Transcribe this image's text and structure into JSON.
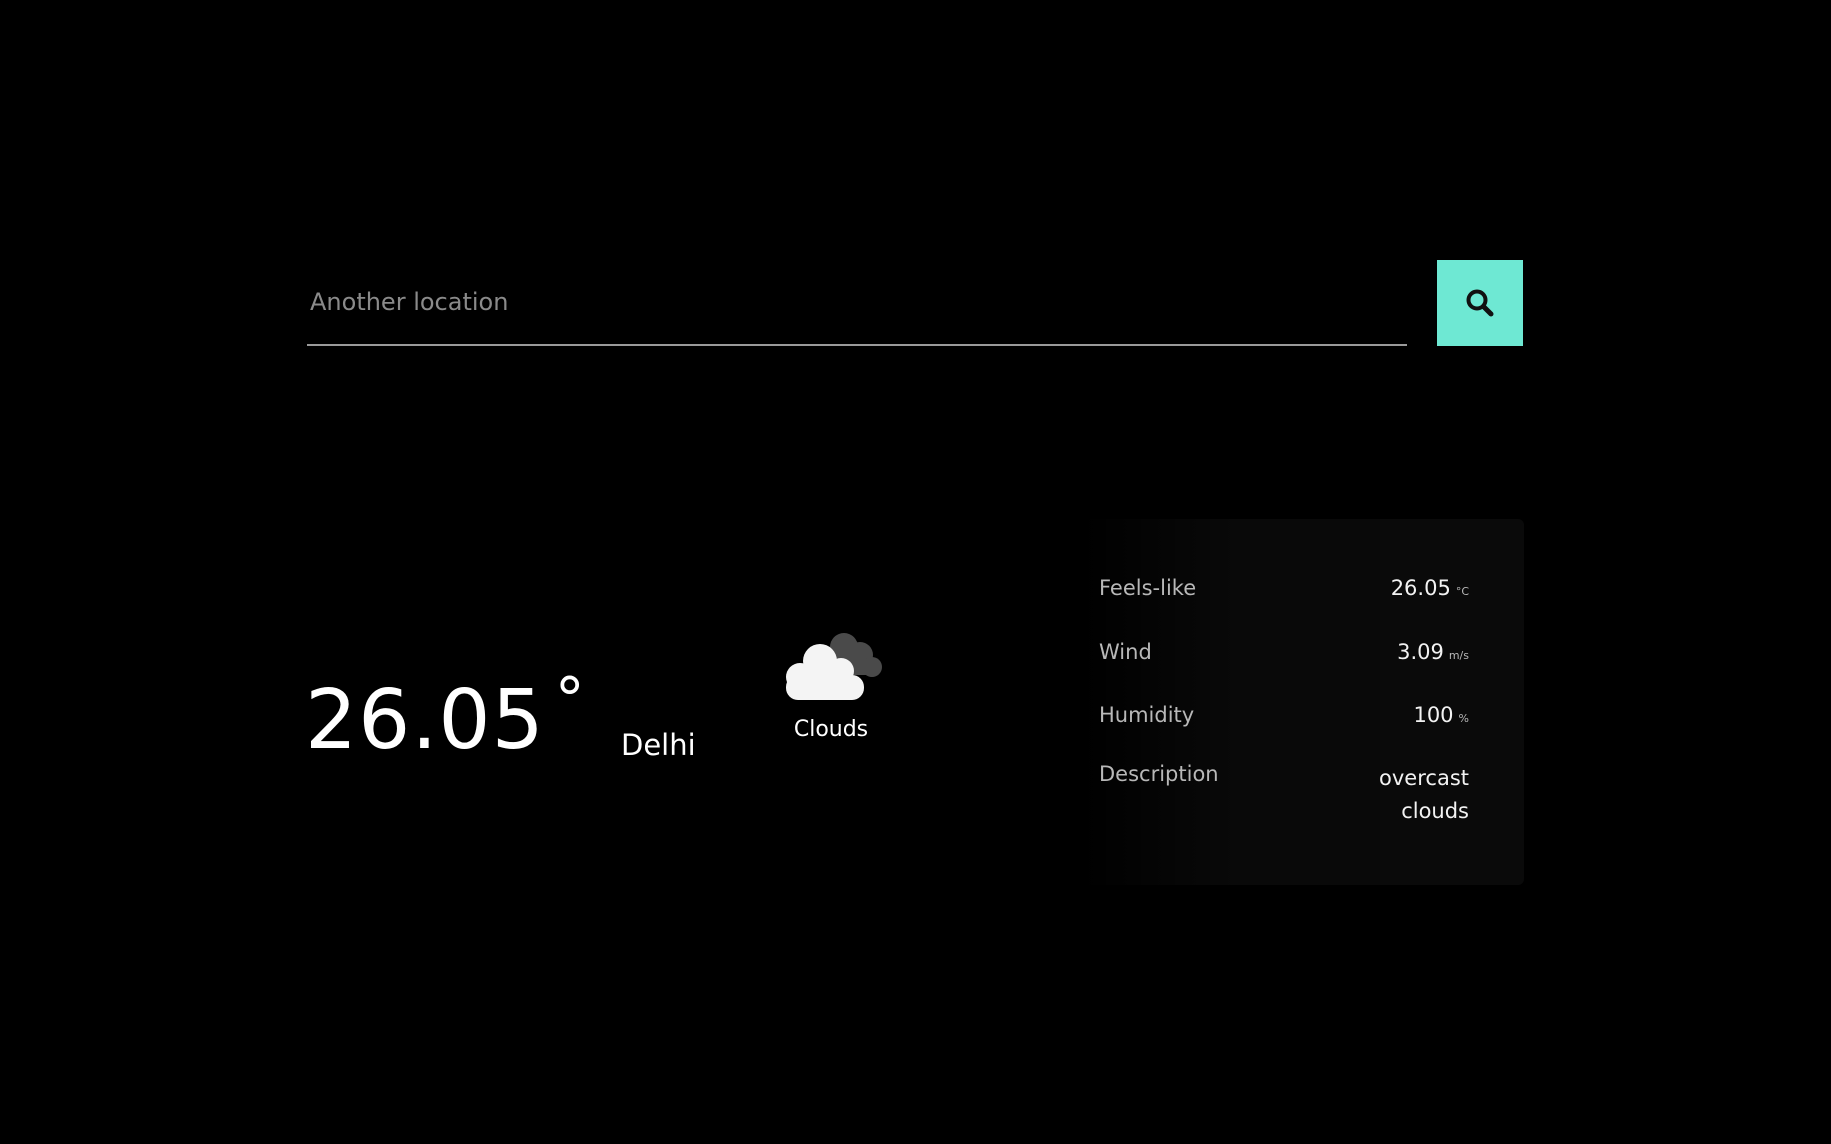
{
  "search": {
    "placeholder": "Another location",
    "value": ""
  },
  "current": {
    "temperature": "26.05",
    "temperature_unit": "°",
    "city": "Delhi",
    "condition": "Clouds",
    "condition_icon": "clouds-icon"
  },
  "details": {
    "feels_like": {
      "label": "Feels-like",
      "value": "26.05",
      "unit": "°C"
    },
    "wind": {
      "label": "Wind",
      "value": "3.09",
      "unit": "m/s"
    },
    "humidity": {
      "label": "Humidity",
      "value": "100",
      "unit": "%"
    },
    "description": {
      "label": "Description",
      "line1": "overcast",
      "line2": "clouds"
    }
  },
  "colors": {
    "background": "#000000",
    "accent": "#6ee8d3",
    "text_primary": "#ffffff",
    "text_secondary": "#b8b8b8"
  }
}
